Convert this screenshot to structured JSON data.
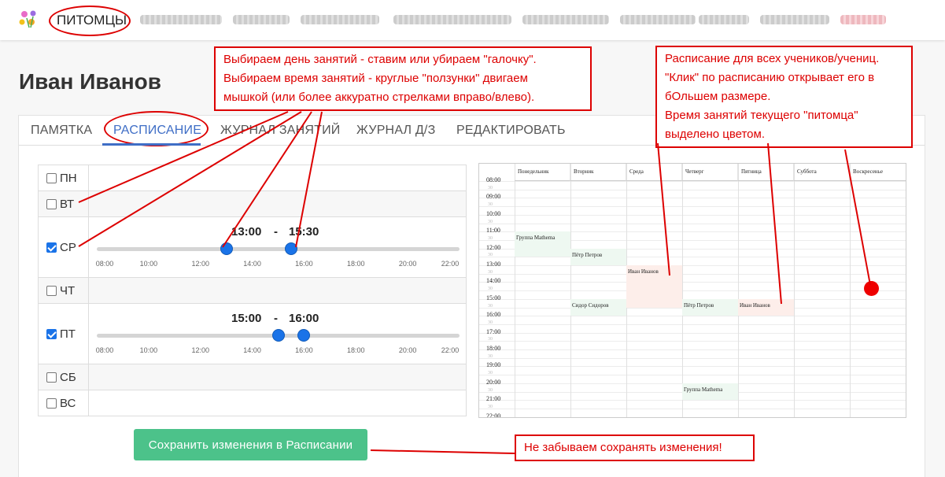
{
  "nav": {
    "active_label": "ПИТОМЦЫ",
    "logo_icon": "flowers-logo-icon",
    "annotation_color": "#dd0000"
  },
  "page": {
    "student_name": "Иван Иванов"
  },
  "tabs": [
    {
      "label": "ПАМЯТКА"
    },
    {
      "label": "РАСПИСАНИЕ"
    },
    {
      "label": "ЖУРНАЛ ЗАНЯТИЙ"
    },
    {
      "label": "ЖУРНАЛ Д/З"
    },
    {
      "label": "РЕДАКТИРОВАТЬ"
    }
  ],
  "days": [
    {
      "label": "ПН",
      "checked": false
    },
    {
      "label": "ВТ",
      "checked": false
    },
    {
      "label": "СР",
      "checked": true,
      "from": "13:00",
      "to": "15:30",
      "from_hours": 13,
      "to_hours": 15.5
    },
    {
      "label": "ЧТ",
      "checked": false
    },
    {
      "label": "ПТ",
      "checked": true,
      "from": "15:00",
      "to": "16:00",
      "from_hours": 15,
      "to_hours": 16
    },
    {
      "label": "СБ",
      "checked": false
    },
    {
      "label": "ВС",
      "checked": false
    }
  ],
  "slider": {
    "range_separator": "-",
    "min_hours": 8,
    "max_hours": 22,
    "ticks": [
      "08:00",
      "10:00",
      "12:00",
      "14:00",
      "16:00",
      "18:00",
      "20:00",
      "22:00"
    ],
    "accent": "#1a73e8"
  },
  "schedule": {
    "columns": [
      "Понедельник",
      "Вторник",
      "Среда",
      "Четверг",
      "Пятница",
      "Суббота",
      "Воскресенье"
    ],
    "hours": [
      "08:00",
      "09:00",
      "10:00",
      "11:00",
      "12:00",
      "13:00",
      "14:00",
      "15:00",
      "16:00",
      "17:00",
      "18:00",
      "19:00",
      "20:00",
      "21:00",
      "22:00"
    ],
    "half_label": "30",
    "entries": [
      {
        "day": 0,
        "start": 11.0,
        "end": 12.5,
        "text": "Группа Mathema",
        "kind": "green"
      },
      {
        "day": 1,
        "start": 12.0,
        "end": 13.0,
        "text": "Пётр Петров",
        "kind": "green"
      },
      {
        "day": 2,
        "start": 13.0,
        "end": 15.5,
        "text": "Иван Иванов",
        "kind": "pink"
      },
      {
        "day": 1,
        "start": 15.0,
        "end": 16.0,
        "text": "Сидор Сидоров",
        "kind": "green"
      },
      {
        "day": 3,
        "start": 15.0,
        "end": 16.0,
        "text": "Пётр Петров",
        "kind": "green"
      },
      {
        "day": 4,
        "start": 15.0,
        "end": 16.0,
        "text": "Иван Иванов",
        "kind": "pink"
      },
      {
        "day": 3,
        "start": 20.0,
        "end": 21.0,
        "text": "Группа Mathema",
        "kind": "green"
      }
    ]
  },
  "save_button": {
    "label": "Сохранить изменения в Расписании",
    "color": "#4cc28a"
  },
  "annotations": {
    "left_note": [
      "Выбираем день занятий - ставим или убираем \"галочку\".",
      "Выбираем время занятий - круглые \"ползунки\" двигаем",
      "мышкой (или более аккуратно стрелками вправо/влево)."
    ],
    "right_note": [
      "Расписание для всех учеников/учениц.",
      "\"Клик\" по расписанию открывает его в",
      "бОльшем размере.",
      "Время занятий текущего \"питомца\"",
      "выделено цветом."
    ],
    "save_note": "Не забываем сохранять изменения!"
  }
}
